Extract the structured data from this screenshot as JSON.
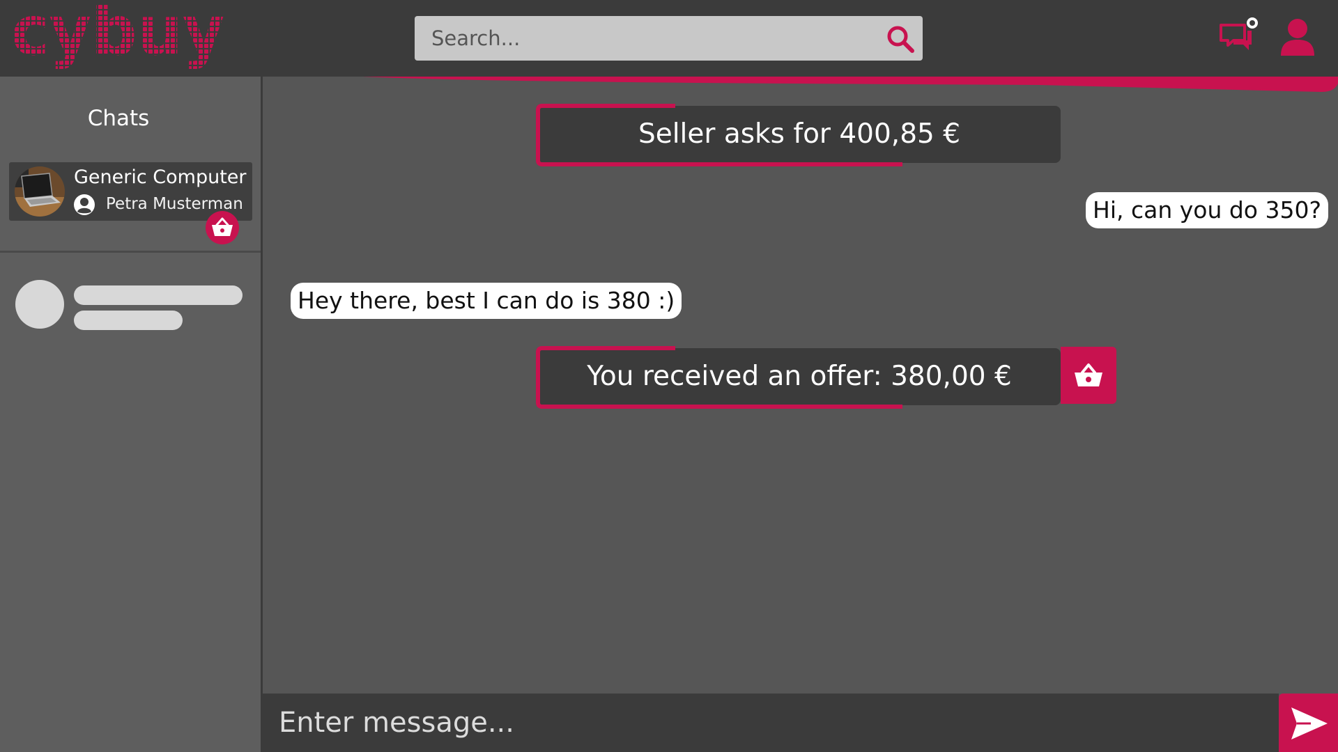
{
  "header": {
    "logo_text": "cybuy",
    "search": {
      "placeholder": "Search...",
      "value": ""
    },
    "icons": {
      "search": "search-icon",
      "chat": "chat-bubbles-icon",
      "chat_notification": "notification-dot-icon",
      "account": "user-icon"
    }
  },
  "sidebar": {
    "title": "Chats",
    "chats": [
      {
        "product": "Generic Computer",
        "person": "Petra Musterman",
        "thumbnail": "laptop-thumbnail",
        "person_icon": "user-circle-icon",
        "badge_icon": "basket-icon"
      }
    ],
    "placeholder_rows": 1
  },
  "conversation": {
    "system_ask": "Seller asks for 400,85 €",
    "messages": [
      {
        "direction": "outgoing",
        "text": "Hi, can you do 350?"
      },
      {
        "direction": "incoming",
        "text": "Hey there, best I can do is 380 :)"
      }
    ],
    "system_offer": "You received an offer: 380,00 €",
    "offer_action_icon": "basket-icon"
  },
  "composer": {
    "placeholder": "Enter message...",
    "value": "",
    "send_icon": "send-icon"
  },
  "colors": {
    "accent": "#c8124f",
    "header_bg": "#3b3b3b",
    "page_bg": "#565656",
    "sidebar_bg": "#5e5e5e",
    "bubble_bg": "#ffffff",
    "search_bg": "#c8c8c8"
  }
}
